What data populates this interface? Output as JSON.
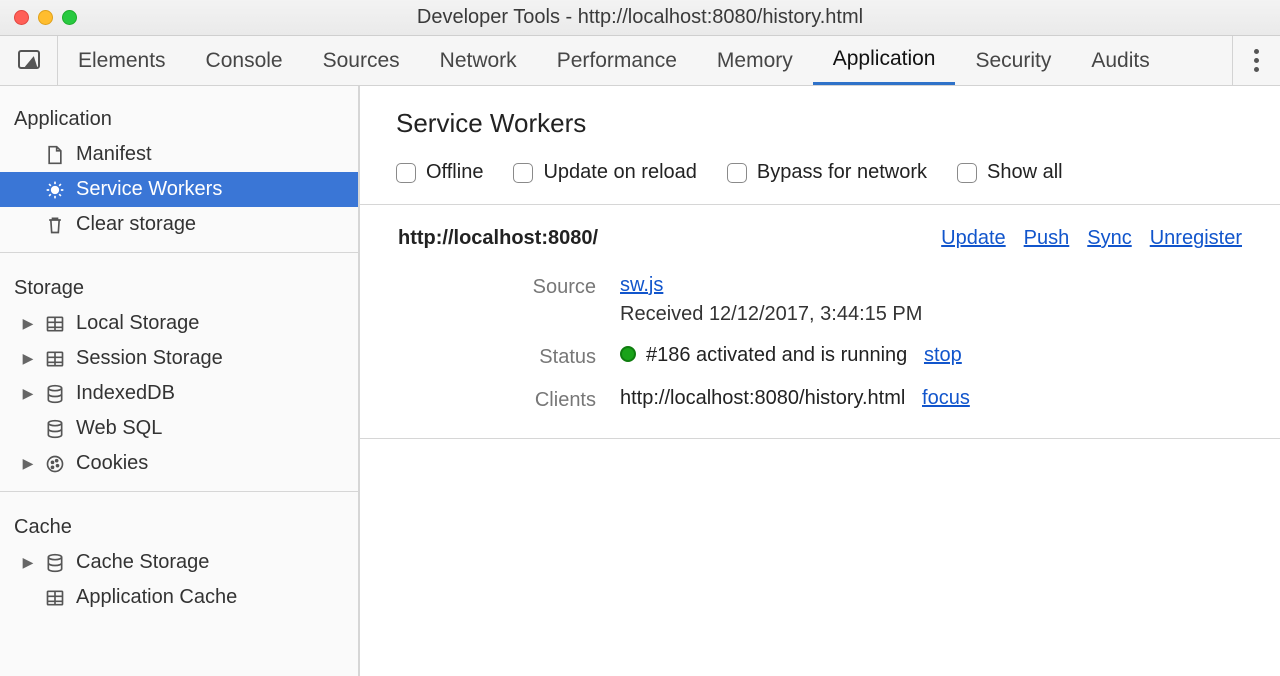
{
  "window": {
    "title": "Developer Tools - http://localhost:8080/history.html"
  },
  "tabs": {
    "items": [
      "Elements",
      "Console",
      "Sources",
      "Network",
      "Performance",
      "Memory",
      "Application",
      "Security",
      "Audits"
    ],
    "active": "Application"
  },
  "sidebar": {
    "groups": [
      {
        "header": "Application",
        "items": [
          {
            "icon": "file-icon",
            "label": "Manifest",
            "expandable": false
          },
          {
            "icon": "gear-icon",
            "label": "Service Workers",
            "expandable": false,
            "active": true
          },
          {
            "icon": "trash-icon",
            "label": "Clear storage",
            "expandable": false
          }
        ]
      },
      {
        "header": "Storage",
        "items": [
          {
            "icon": "table-icon",
            "label": "Local Storage",
            "expandable": true
          },
          {
            "icon": "table-icon",
            "label": "Session Storage",
            "expandable": true
          },
          {
            "icon": "db-icon",
            "label": "IndexedDB",
            "expandable": true
          },
          {
            "icon": "db-icon",
            "label": "Web SQL",
            "expandable": false
          },
          {
            "icon": "cookie-icon",
            "label": "Cookies",
            "expandable": true
          }
        ]
      },
      {
        "header": "Cache",
        "items": [
          {
            "icon": "db-icon",
            "label": "Cache Storage",
            "expandable": true
          },
          {
            "icon": "table-icon",
            "label": "Application Cache",
            "expandable": false
          }
        ]
      }
    ]
  },
  "service_workers": {
    "title": "Service Workers",
    "checks": {
      "offline": "Offline",
      "update_on_reload": "Update on reload",
      "bypass": "Bypass for network",
      "show_all": "Show all"
    },
    "registration": {
      "scope": "http://localhost:8080/",
      "actions": {
        "update": "Update",
        "push": "Push",
        "sync": "Sync",
        "unregister": "Unregister"
      },
      "rows": {
        "source_label": "Source",
        "source_link": "sw.js",
        "source_received_prefix": "Received ",
        "source_received_ts": "12/12/2017, 3:44:15 PM",
        "status_label": "Status",
        "status_text": "#186 activated and is running",
        "status_stop": "stop",
        "clients_label": "Clients",
        "clients_url": "http://localhost:8080/history.html",
        "clients_focus": "focus"
      }
    }
  }
}
